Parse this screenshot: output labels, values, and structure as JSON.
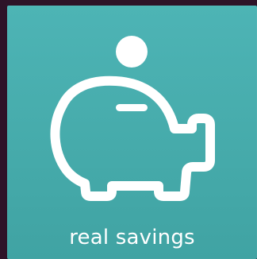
{
  "tile": {
    "label": "real savings",
    "icon": "piggy-bank-icon",
    "background_color": "#46abab",
    "foreground_color": "#ffffff"
  },
  "page": {
    "background_color": "#2e1328"
  }
}
